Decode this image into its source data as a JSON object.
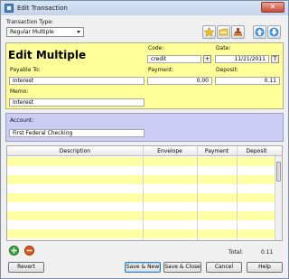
{
  "window": {
    "title": "Edit Transaction",
    "close_glyph": "✕"
  },
  "transaction_type": {
    "label": "Transaction Type:",
    "value": "Regular Multiple"
  },
  "toolbar": {
    "icons": [
      "star-icon",
      "folder-icon",
      "stamp-icon",
      "arrow-up-icon",
      "arrow-down-icon"
    ]
  },
  "form": {
    "heading": "Edit Multiple",
    "code_label": "Code:",
    "code_value": "credit",
    "code_add": "+",
    "date_label": "Date:",
    "date_value": "11/21/2011",
    "date_today": "T",
    "payable_label": "Payable To:",
    "payable_value": "Interest",
    "payment_label": "Payment:",
    "payment_value": "0.00",
    "deposit_label": "Deposit:",
    "deposit_value": "0.11",
    "memo_label": "Memo:",
    "memo_value": "Interest"
  },
  "account": {
    "label": "Account:",
    "value": "First Federal Checking"
  },
  "grid": {
    "columns": [
      "Description",
      "Envelope",
      "Payment",
      "Deposit"
    ],
    "rows": []
  },
  "footer": {
    "total_label": "Total:",
    "total_value": "0.11",
    "add_glyph": "+",
    "remove_glyph": "−",
    "revert": "Revert",
    "save_new": "Save & New",
    "save_close": "Save & Close",
    "cancel": "Cancel",
    "help": "Help"
  },
  "colors": {
    "form_panel": "#ffff99",
    "account_panel": "#ccccf5",
    "grid_alt_row": "#ffffa6",
    "add_button": "#3aa83a",
    "remove_button": "#e0561e"
  }
}
